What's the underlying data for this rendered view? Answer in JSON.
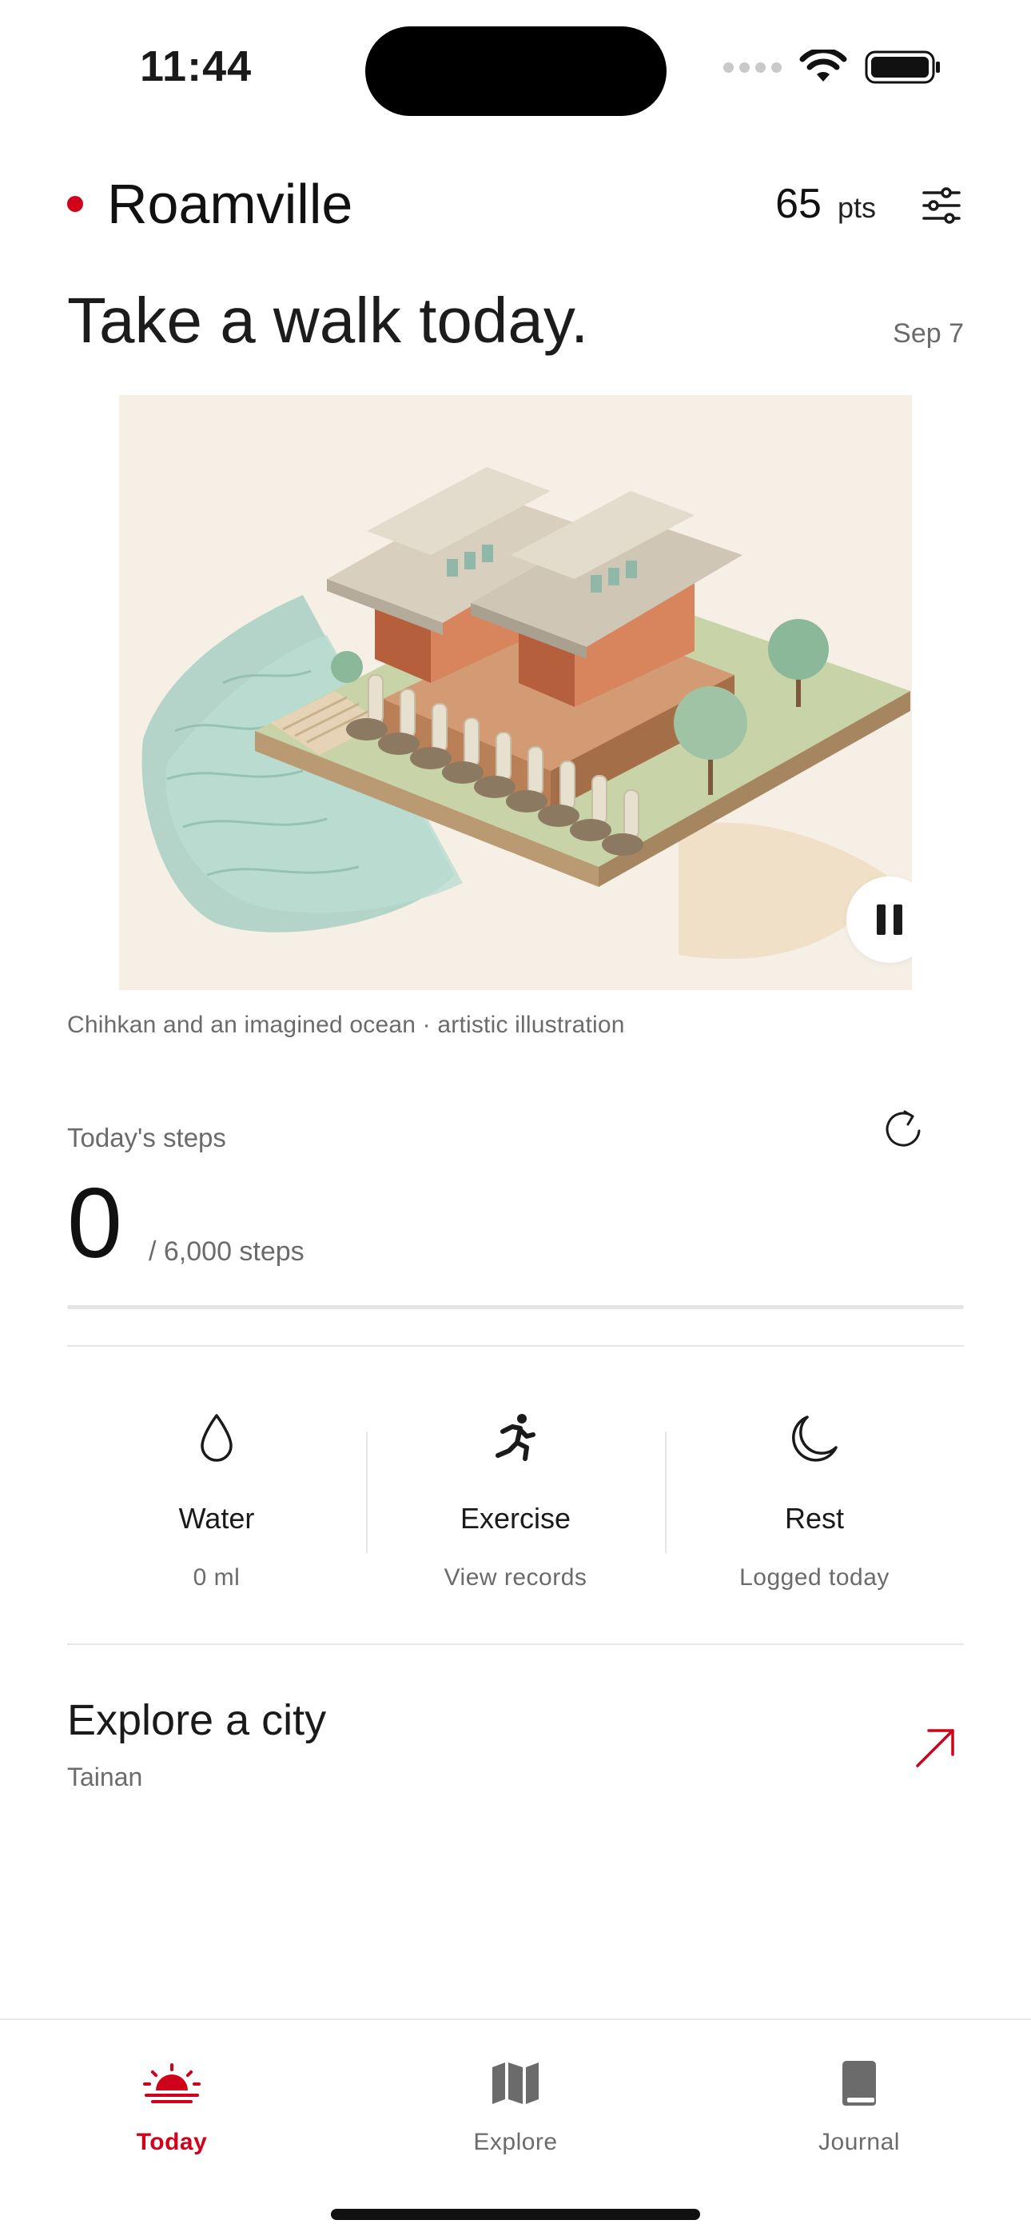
{
  "status_bar": {
    "time": "11:44"
  },
  "header": {
    "app_name": "Roamville",
    "points_value": "65",
    "points_unit": "pts"
  },
  "greeting": {
    "title": "Take a walk today.",
    "date": "Sep 7"
  },
  "hero": {
    "caption": "Chihkan and an imagined ocean · artistic illustration"
  },
  "steps": {
    "label": "Today's steps",
    "count": "0",
    "goal_text": "/ 6,000 steps",
    "progress": 0
  },
  "stats": [
    {
      "icon": "water-drop-icon",
      "title": "Water",
      "subtitle": "0 ml"
    },
    {
      "icon": "running-icon",
      "title": "Exercise",
      "subtitle": "View records"
    },
    {
      "icon": "moon-icon",
      "title": "Rest",
      "subtitle": "Logged today"
    }
  ],
  "explore": {
    "title": "Explore a city",
    "city": "Tainan"
  },
  "tabs": [
    {
      "icon": "sunrise-icon",
      "label": "Today",
      "active": true
    },
    {
      "icon": "map-icon",
      "label": "Explore",
      "active": false
    },
    {
      "icon": "book-icon",
      "label": "Journal",
      "active": false
    }
  ],
  "colors": {
    "accent": "#d0021b",
    "text_primary": "#1a1a1a",
    "text_secondary": "#6b6b6b"
  }
}
